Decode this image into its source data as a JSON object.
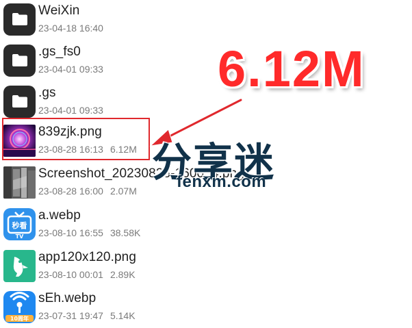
{
  "files": [
    {
      "name": "WeiXin",
      "date": "23-04-18 16:40",
      "size": "",
      "type": "folder",
      "icon": "folder-icon"
    },
    {
      "name": ".gs_fs0",
      "date": "23-04-01 09:33",
      "size": "",
      "type": "folder",
      "icon": "folder-icon"
    },
    {
      "name": ".gs",
      "date": "23-04-01 09:33",
      "size": "",
      "type": "folder",
      "icon": "folder-icon"
    },
    {
      "name": "839zjk.png",
      "date": "23-08-28 16:13",
      "size": "6.12M",
      "type": "image",
      "icon": "image-thumbnail"
    },
    {
      "name": "Screenshot_20230828-160054.png",
      "date": "23-08-28 16:00",
      "size": "2.07M",
      "type": "image",
      "icon": "screenshot-thumbnail"
    },
    {
      "name": "a.webp",
      "date": "23-08-10 16:55",
      "size": "38.58K",
      "type": "image",
      "icon": "tv-app-icon"
    },
    {
      "name": "app120x120.png",
      "date": "23-08-10 00:01",
      "size": "2.89K",
      "type": "image",
      "icon": "bird-app-icon"
    },
    {
      "name": "sEh.webp",
      "date": "23-07-31 19:47",
      "size": "5.14K",
      "type": "image",
      "icon": "signal-app-icon"
    }
  ],
  "annotation": {
    "text": "6.12M",
    "color": "#ff2a2a"
  },
  "app_icons": {
    "tv_label": "秒看",
    "tv_sub": "TV",
    "signal_badge": "10周年"
  },
  "watermark": {
    "chinese": "分享迷",
    "url": "fenxm.com"
  },
  "colors": {
    "folder": "#2a2a2a",
    "highlight": "#e0282d",
    "meta_text": "#7a7a7a"
  }
}
